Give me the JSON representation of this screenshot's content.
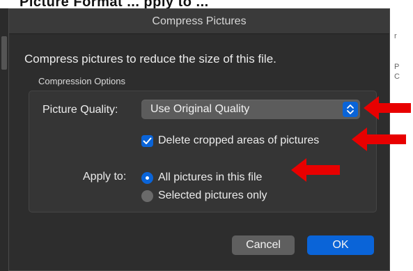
{
  "background_app": {
    "partial_title": "Picture Format  ...  pply to  ...",
    "right_hints": [
      "P",
      "C",
      "r"
    ]
  },
  "dialog": {
    "title": "Compress Pictures",
    "intro": "Compress pictures to reduce the size of this file.",
    "group_title": "Compression Options",
    "picture_quality": {
      "label": "Picture Quality:",
      "value": "Use Original Quality"
    },
    "delete_cropped": {
      "label": "Delete cropped areas of pictures",
      "checked": true
    },
    "apply_to": {
      "label": "Apply to:",
      "options": [
        {
          "label": "All pictures in this file",
          "selected": true
        },
        {
          "label": "Selected pictures only",
          "selected": false
        }
      ]
    },
    "buttons": {
      "cancel": "Cancel",
      "ok": "OK"
    }
  },
  "annotations": {
    "arrow_color": "#e80000",
    "arrow_count": 4
  },
  "colors": {
    "dialog_bg": "#2d2d2d",
    "accent_blue": "#0a64d8",
    "annotation_red": "#e80000"
  }
}
